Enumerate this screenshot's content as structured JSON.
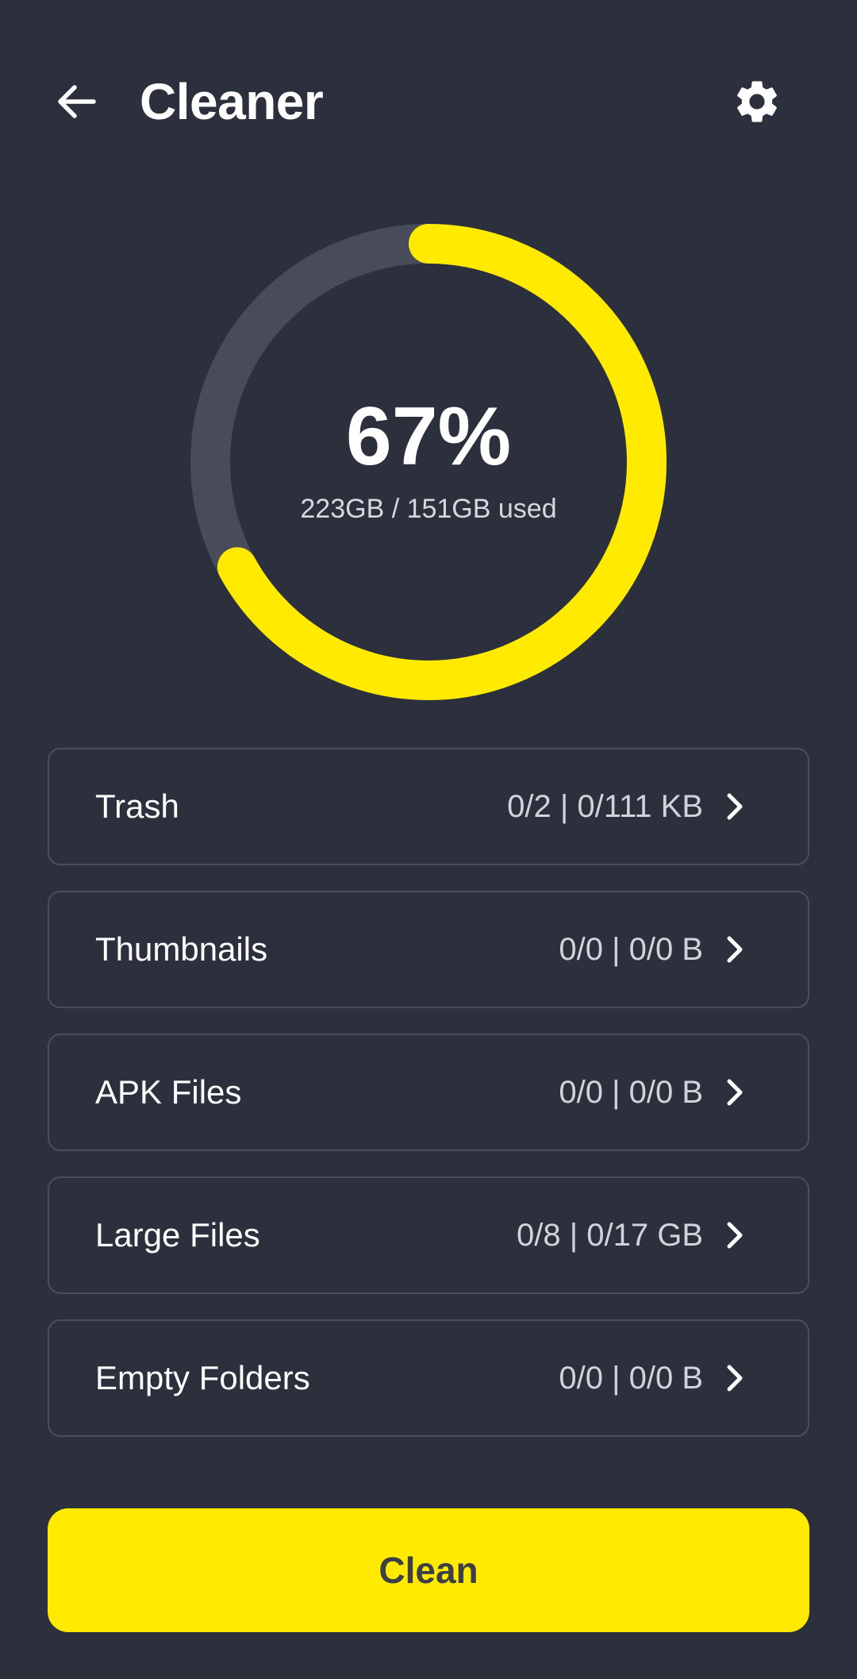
{
  "header": {
    "title": "Cleaner",
    "back_icon": "arrow-left-icon",
    "settings_icon": "gear-icon"
  },
  "storage": {
    "percent_value": 0.67,
    "percent_label": "67%",
    "usage_label": "223GB / 151GB used"
  },
  "categories": [
    {
      "label": "Trash",
      "value": "0/2 | 0/111 KB"
    },
    {
      "label": "Thumbnails",
      "value": "0/0 | 0/0 B"
    },
    {
      "label": "APK Files",
      "value": "0/0 | 0/0 B"
    },
    {
      "label": "Large Files",
      "value": "0/8 | 0/17 GB"
    },
    {
      "label": "Empty Folders",
      "value": "0/0 | 0/0 B"
    }
  ],
  "actions": {
    "clean_label": "Clean"
  },
  "colors": {
    "background": "#2c303c",
    "accent": "#ffea00",
    "track": "#474c58",
    "border": "#4a4f5b"
  }
}
